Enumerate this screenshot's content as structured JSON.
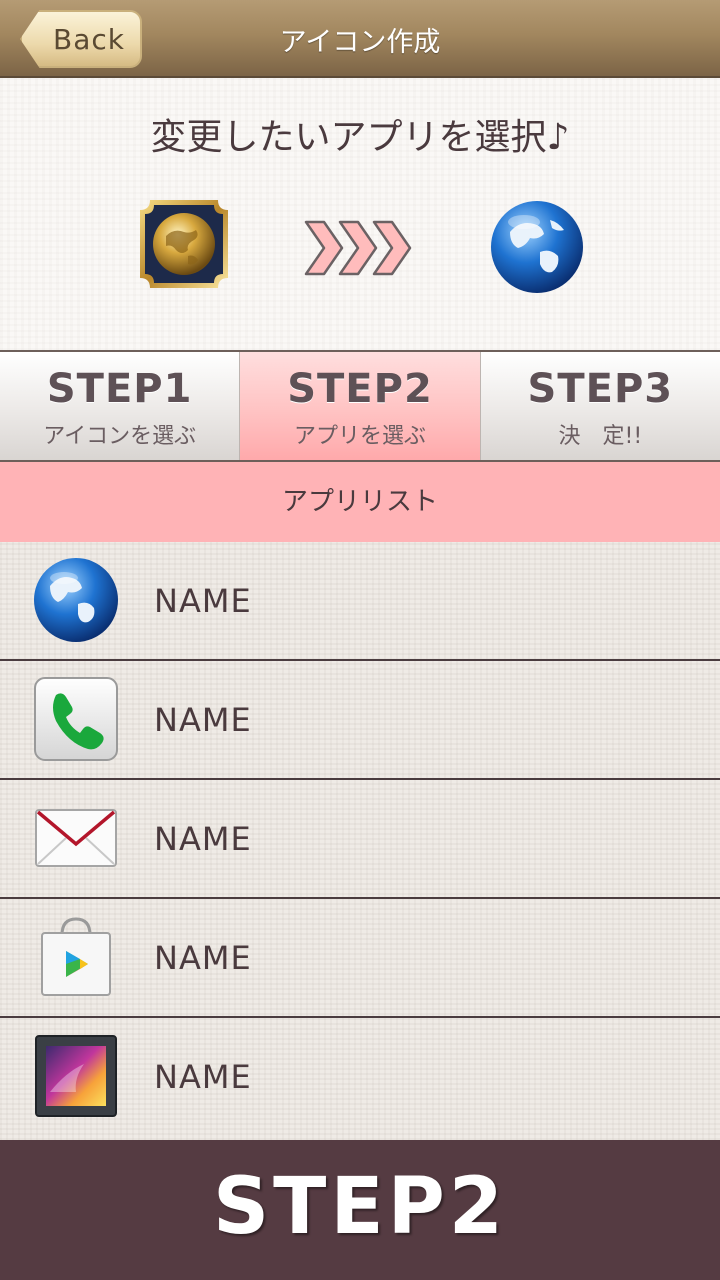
{
  "header": {
    "back_label": "Back",
    "title": "アイコン作成"
  },
  "selection": {
    "title": "変更したいアプリを選択♪",
    "source_icon": "gold-globe-icon",
    "arrow_icon": "triple-chevron-right-icon",
    "target_icon": "globe-icon"
  },
  "steps": [
    {
      "title": "STEP1",
      "subtitle": "アイコンを選ぶ",
      "active": false
    },
    {
      "title": "STEP2",
      "subtitle": "アプリを選ぶ",
      "active": true
    },
    {
      "title": "STEP3",
      "subtitle": "決　定!!",
      "active": false
    }
  ],
  "app_list": {
    "header": "アプリリスト",
    "items": [
      {
        "name": "NAME",
        "icon": "browser-globe-icon"
      },
      {
        "name": "NAME",
        "icon": "phone-icon"
      },
      {
        "name": "NAME",
        "icon": "mail-icon"
      },
      {
        "name": "NAME",
        "icon": "play-store-icon"
      },
      {
        "name": "NAME",
        "icon": "gallery-icon"
      }
    ]
  },
  "footer": {
    "label": "STEP2"
  },
  "colors": {
    "header_brown": "#a2875f",
    "active_step_pink": "#ffb3b6",
    "list_header_pink": "#ffb3b6",
    "footer_plum": "#553b42",
    "text_dark": "#4a3a3e"
  }
}
